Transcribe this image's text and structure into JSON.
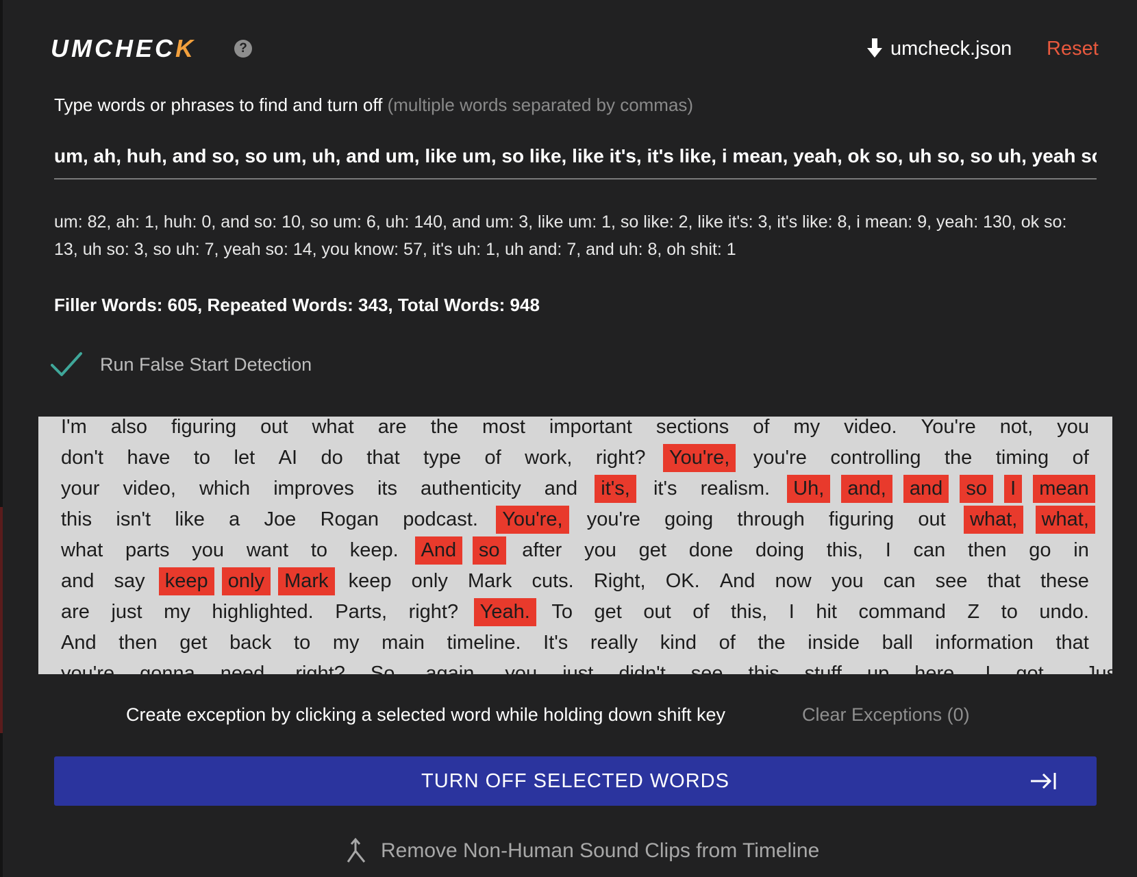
{
  "header": {
    "logo_text": "UMCHEC",
    "logo_accent": "K",
    "help_glyph": "?",
    "download_label": "umcheck.json",
    "reset_label": "Reset"
  },
  "prompt": {
    "label": "Type words or phrases to find and turn off",
    "hint": "(multiple words separated by commas)"
  },
  "phrase_input": {
    "value": "um, ah, huh, and so, so um, uh, and um, like um, so like, like it's, it's like, i mean, yeah, ok so, uh so, so uh, yeah so, yo"
  },
  "counts_text": "um: 82, ah: 1, huh: 0, and so: 10, so um: 6, uh: 140, and um: 3, like um: 1, so like: 2, like it's: 3, it's like: 8, i mean: 9, yeah: 130, ok so: 13, uh so: 3, so uh: 7, yeah so: 14, you know: 57, it's uh: 1, uh and: 7, and uh: 8, oh shit: 1",
  "totals_text": "Filler Words: 605, Repeated Words: 343, Total Words: 948",
  "false_start": {
    "label": "Run False Start Detection",
    "checked": true
  },
  "transcript": {
    "highlight_color": "#e83a2c",
    "lines": [
      [
        {
          "t": "I'm"
        },
        {
          "t": "also"
        },
        {
          "t": "figuring"
        },
        {
          "t": "out"
        },
        {
          "t": "what"
        },
        {
          "t": "are"
        },
        {
          "t": "the"
        },
        {
          "t": "most"
        },
        {
          "t": "important"
        },
        {
          "t": "sections"
        },
        {
          "t": "of"
        },
        {
          "t": "my"
        },
        {
          "t": "video."
        },
        {
          "t": "You're"
        },
        {
          "t": "not,"
        },
        {
          "t": "you"
        }
      ],
      [
        {
          "t": "don't"
        },
        {
          "t": "have"
        },
        {
          "t": "to"
        },
        {
          "t": "let"
        },
        {
          "t": "AI"
        },
        {
          "t": "do"
        },
        {
          "t": "that"
        },
        {
          "t": "type"
        },
        {
          "t": "of"
        },
        {
          "t": "work,"
        },
        {
          "t": "right?"
        },
        {
          "t": "You're,",
          "s": true
        },
        {
          "t": "you're"
        },
        {
          "t": "controlling"
        },
        {
          "t": "the"
        },
        {
          "t": "timing"
        },
        {
          "t": "of"
        }
      ],
      [
        {
          "t": "your"
        },
        {
          "t": "video,"
        },
        {
          "t": "which"
        },
        {
          "t": "improves"
        },
        {
          "t": "its"
        },
        {
          "t": "authenticity"
        },
        {
          "t": "and"
        },
        {
          "t": "it's,",
          "s": true
        },
        {
          "t": "it's"
        },
        {
          "t": "realism."
        },
        {
          "t": "Uh,",
          "s": true
        },
        {
          "t": "and,",
          "s": true
        },
        {
          "t": "and",
          "s": true
        },
        {
          "t": "so",
          "s": true
        },
        {
          "t": "I",
          "s": true
        },
        {
          "t": "mean",
          "s": true
        }
      ],
      [
        {
          "t": "this"
        },
        {
          "t": "isn't"
        },
        {
          "t": "like"
        },
        {
          "t": "a"
        },
        {
          "t": "Joe"
        },
        {
          "t": "Rogan"
        },
        {
          "t": "podcast."
        },
        {
          "t": "You're,",
          "s": true
        },
        {
          "t": "you're"
        },
        {
          "t": "going"
        },
        {
          "t": "through"
        },
        {
          "t": "figuring"
        },
        {
          "t": "out"
        },
        {
          "t": "what,",
          "s": true
        },
        {
          "t": "what,",
          "s": true
        }
      ],
      [
        {
          "t": "what"
        },
        {
          "t": "parts"
        },
        {
          "t": "you"
        },
        {
          "t": "want"
        },
        {
          "t": "to"
        },
        {
          "t": "keep."
        },
        {
          "t": "And",
          "s": true
        },
        {
          "t": "so",
          "s": true
        },
        {
          "t": "after"
        },
        {
          "t": "you"
        },
        {
          "t": "get"
        },
        {
          "t": "done"
        },
        {
          "t": "doing"
        },
        {
          "t": "this,"
        },
        {
          "t": "I"
        },
        {
          "t": "can"
        },
        {
          "t": "then"
        },
        {
          "t": "go"
        },
        {
          "t": "in"
        }
      ],
      [
        {
          "t": "and"
        },
        {
          "t": "say"
        },
        {
          "t": "keep",
          "s": true
        },
        {
          "t": "only",
          "s": true
        },
        {
          "t": "Mark",
          "s": true
        },
        {
          "t": "keep"
        },
        {
          "t": "only"
        },
        {
          "t": "Mark"
        },
        {
          "t": "cuts."
        },
        {
          "t": "Right,"
        },
        {
          "t": "OK."
        },
        {
          "t": "And"
        },
        {
          "t": "now"
        },
        {
          "t": "you"
        },
        {
          "t": "can"
        },
        {
          "t": "see"
        },
        {
          "t": "that"
        },
        {
          "t": "these"
        }
      ],
      [
        {
          "t": "are"
        },
        {
          "t": "just"
        },
        {
          "t": "my"
        },
        {
          "t": "highlighted."
        },
        {
          "t": "Parts,"
        },
        {
          "t": "right?"
        },
        {
          "t": "Yeah.",
          "s": true
        },
        {
          "t": "To"
        },
        {
          "t": "get"
        },
        {
          "t": "out"
        },
        {
          "t": "of"
        },
        {
          "t": "this,"
        },
        {
          "t": "I"
        },
        {
          "t": "hit"
        },
        {
          "t": "command"
        },
        {
          "t": "Z"
        },
        {
          "t": "to"
        },
        {
          "t": "undo."
        }
      ],
      [
        {
          "t": "And"
        },
        {
          "t": "then"
        },
        {
          "t": "get"
        },
        {
          "t": "back"
        },
        {
          "t": "to"
        },
        {
          "t": "my"
        },
        {
          "t": "main"
        },
        {
          "t": "timeline."
        },
        {
          "t": "It's"
        },
        {
          "t": "really"
        },
        {
          "t": "kind"
        },
        {
          "t": "of"
        },
        {
          "t": "the"
        },
        {
          "t": "inside"
        },
        {
          "t": "ball"
        },
        {
          "t": "information"
        },
        {
          "t": "that"
        }
      ],
      [
        {
          "t": "you're"
        },
        {
          "t": "gonna"
        },
        {
          "t": "need,"
        },
        {
          "t": "right?"
        },
        {
          "t": "So,"
        },
        {
          "t": "again,"
        },
        {
          "t": "you"
        },
        {
          "t": "just"
        },
        {
          "t": "didn't"
        },
        {
          "t": "see"
        },
        {
          "t": "this"
        },
        {
          "t": "stuff"
        },
        {
          "t": "up"
        },
        {
          "t": "here."
        },
        {
          "t": "I"
        },
        {
          "t": "got..."
        },
        {
          "t": "Just"
        }
      ]
    ]
  },
  "exceptions": {
    "note": "Create exception by clicking a selected word while holding down shift key",
    "clear_label": "Clear Exceptions (0)"
  },
  "turn_off_button": {
    "label": "TURN OFF SELECTED WORDS"
  },
  "remove_nonhuman": {
    "label": "Remove Non-Human Sound Clips from Timeline"
  }
}
